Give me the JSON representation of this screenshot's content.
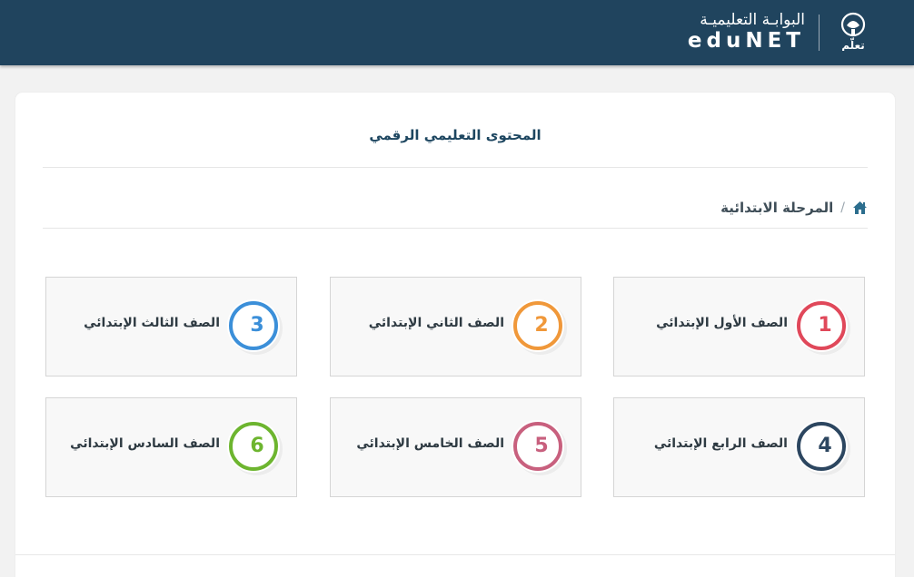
{
  "header": {
    "brand_arabic": "البوابـة التعليميـة",
    "brand_english": "eduNET",
    "logo_text": "تعلّم"
  },
  "content": {
    "title": "المحتوى التعليمي الرقمي",
    "breadcrumb": {
      "home_icon": "home-icon",
      "separator": "/",
      "current": "المرحلة الابتدائية"
    }
  },
  "grades": [
    {
      "number": "1",
      "label": "الصف الأول الإبتدائي",
      "color": "#e0485a"
    },
    {
      "number": "2",
      "label": "الصف الثاني الإبتدائي",
      "color": "#f0983a"
    },
    {
      "number": "3",
      "label": "الصف الثالث الإبتدائي",
      "color": "#3b8fd9"
    },
    {
      "number": "4",
      "label": "الصف الرابع الإبتدائي",
      "color": "#2c4660"
    },
    {
      "number": "5",
      "label": "الصف الخامس الإبتدائي",
      "color": "#c8607e"
    },
    {
      "number": "6",
      "label": "الصف السادس الإبتدائي",
      "color": "#6db52f"
    }
  ],
  "colors": {
    "header_bg": "#20445e",
    "title_text": "#1d4660",
    "page_bg": "#f2f2f2"
  }
}
